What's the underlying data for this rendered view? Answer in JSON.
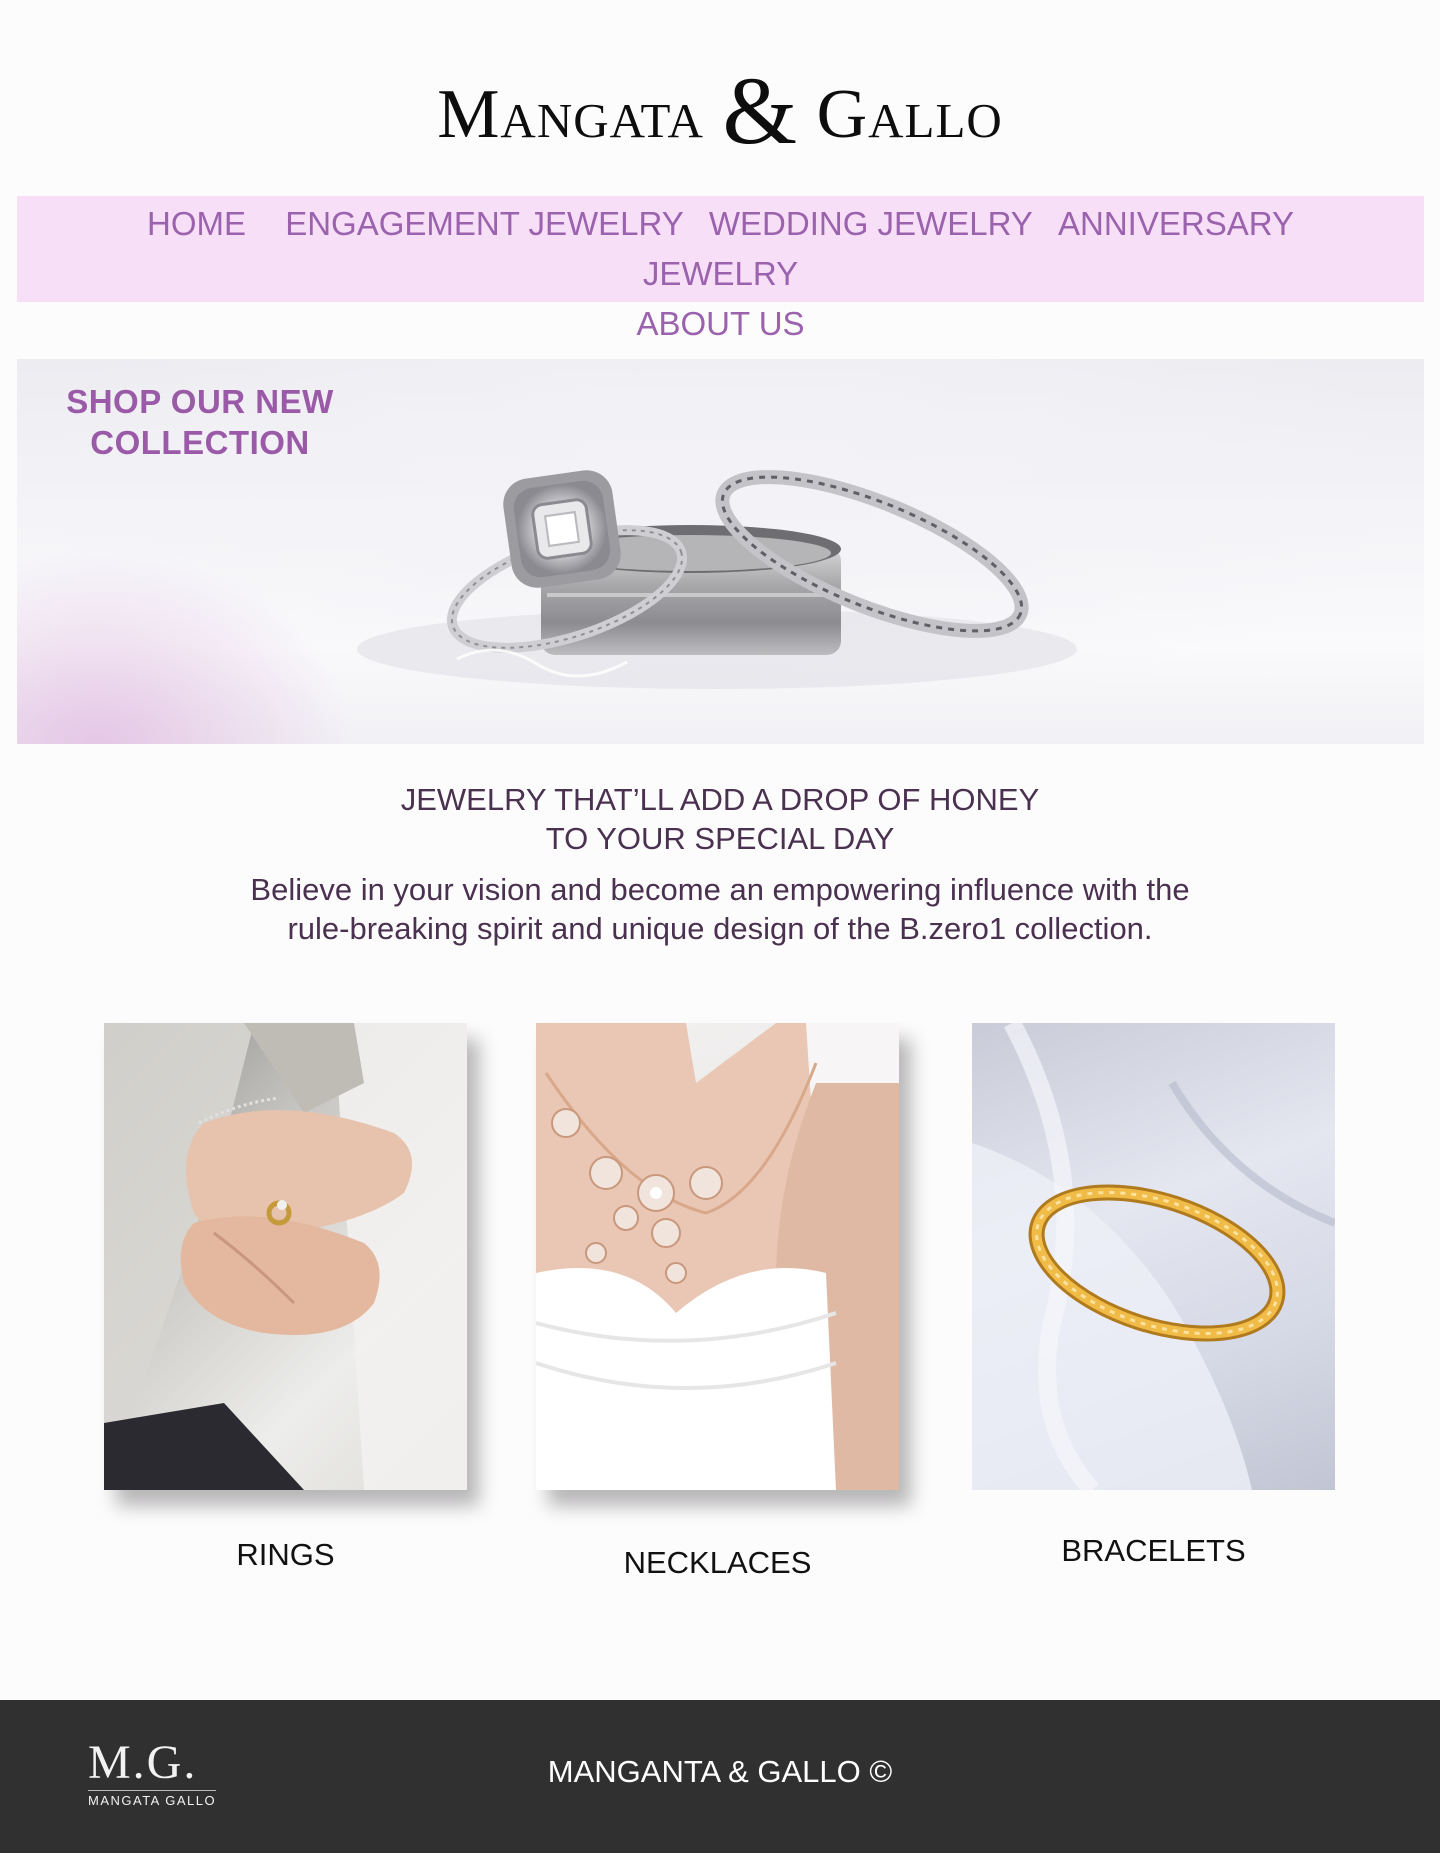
{
  "brand": {
    "name_part1": "Mangata",
    "ampersand": "&",
    "name_part2": "Gallo"
  },
  "nav": {
    "items": [
      {
        "label": "HOME"
      },
      {
        "label": "ENGAGEMENT JEWELRY"
      },
      {
        "label": "WEDDING JEWELRY"
      },
      {
        "label": "ANNIVERSARY"
      },
      {
        "label": "JEWELRY"
      },
      {
        "label": "ABOUT US"
      }
    ]
  },
  "hero": {
    "title_line1": "SHOP OUR NEW",
    "title_line2": "COLLECTION",
    "image": "wedding-rings-photo"
  },
  "intro": {
    "heading_line1": "JEWELRY THAT’LL ADD A DROP OF HONEY",
    "heading_line2": "TO YOUR SPECIAL DAY",
    "body_line1": "Believe in your vision and become an empowering influence with the",
    "body_line2": "rule-breaking spirit and unique design of the B.zero1 collection."
  },
  "categories": [
    {
      "label": "RINGS",
      "image": "hands-with-rings-photo"
    },
    {
      "label": "NECKLACES",
      "image": "bride-necklace-photo"
    },
    {
      "label": "BRACELETS",
      "image": "gold-bracelet-photo"
    }
  ],
  "footer": {
    "logo_mark": "M.G.",
    "logo_sub": "MANGATA GALLO",
    "copyright": "MANGANTA & GALLO ©"
  },
  "colors": {
    "nav_bg": "#f7dff7",
    "accent_purple": "#9b62ad",
    "text_plum": "#4a3150",
    "footer_bg": "#303030"
  }
}
